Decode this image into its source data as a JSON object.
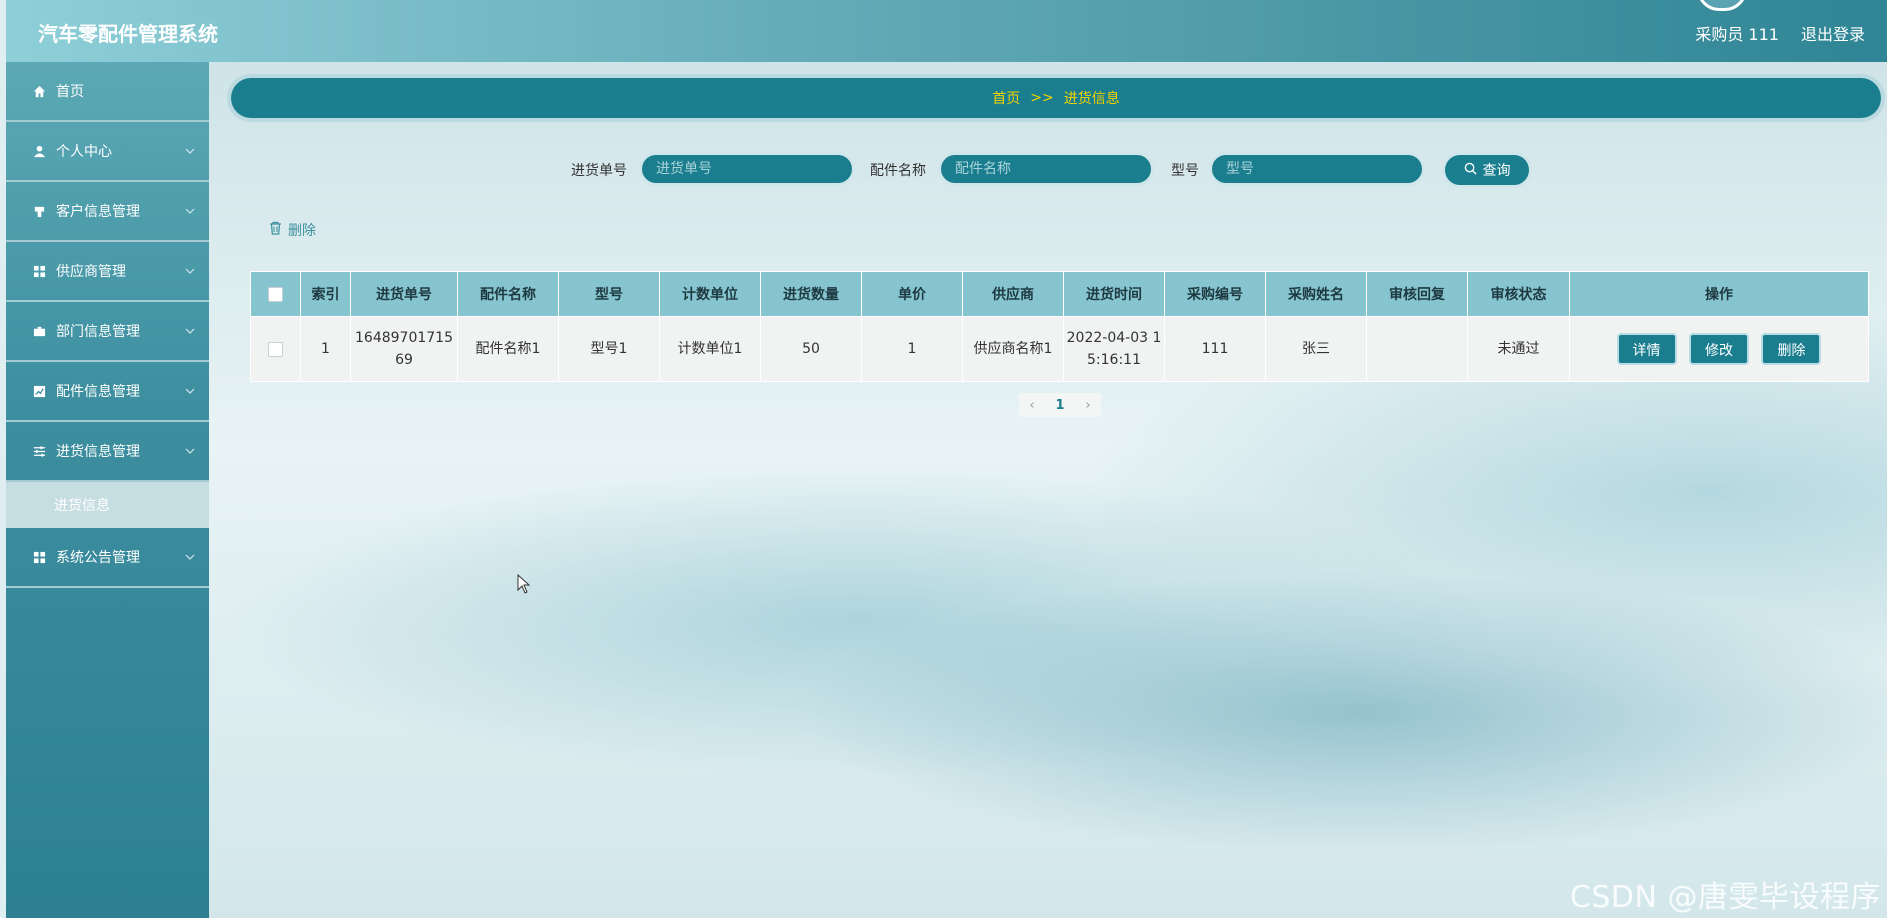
{
  "app": {
    "title": "汽车零配件管理系统",
    "user_label": "采购员 111",
    "logout_label": "退出登录"
  },
  "sidebar": {
    "items": [
      {
        "label": "首页",
        "icon": "home-icon",
        "has_chevron": false
      },
      {
        "label": "个人中心",
        "icon": "user-icon",
        "has_chevron": true
      },
      {
        "label": "客户信息管理",
        "icon": "customer-icon",
        "has_chevron": true
      },
      {
        "label": "供应商管理",
        "icon": "grid-icon",
        "has_chevron": true
      },
      {
        "label": "部门信息管理",
        "icon": "briefcase-icon",
        "has_chevron": true
      },
      {
        "label": "配件信息管理",
        "icon": "chart-icon",
        "has_chevron": true
      },
      {
        "label": "进货信息管理",
        "icon": "sliders-icon",
        "has_chevron": true
      },
      {
        "label": "系统公告管理",
        "icon": "grid-icon",
        "has_chevron": true
      }
    ],
    "sub_item": "进货信息"
  },
  "breadcrumb": {
    "home": "首页",
    "separator": ">>",
    "current": "进货信息"
  },
  "search": {
    "order_no_label": "进货单号",
    "order_no_placeholder": "进货单号",
    "part_name_label": "配件名称",
    "part_name_placeholder": "配件名称",
    "model_label": "型号",
    "model_placeholder": "型号",
    "query_label": "查询"
  },
  "toolbar": {
    "delete_label": "删除"
  },
  "table": {
    "headers": [
      "索引",
      "进货单号",
      "配件名称",
      "型号",
      "计数单位",
      "进货数量",
      "单价",
      "供应商",
      "进货时间",
      "采购编号",
      "采购姓名",
      "审核回复",
      "审核状态",
      "操作"
    ],
    "rows": [
      {
        "index": "1",
        "order_no": "1648970171569",
        "part_name": "配件名称1",
        "model": "型号1",
        "unit": "计数单位1",
        "quantity": "50",
        "price": "1",
        "supplier": "供应商名称1",
        "time": "2022-04-03 15:16:11",
        "buyer_no": "111",
        "buyer_name": "张三",
        "review_reply": "",
        "review_status": "未通过",
        "actions": {
          "detail": "详情",
          "edit": "修改",
          "delete": "删除"
        }
      }
    ]
  },
  "pagination": {
    "current_page": "1",
    "prev": "‹",
    "next": "›"
  },
  "watermark": "CSDN @唐雯毕设程序",
  "colors": {
    "accent": "#1b7e8f",
    "breadcrumb_text": "#f2d200",
    "header_bg": "#86c4d0"
  }
}
